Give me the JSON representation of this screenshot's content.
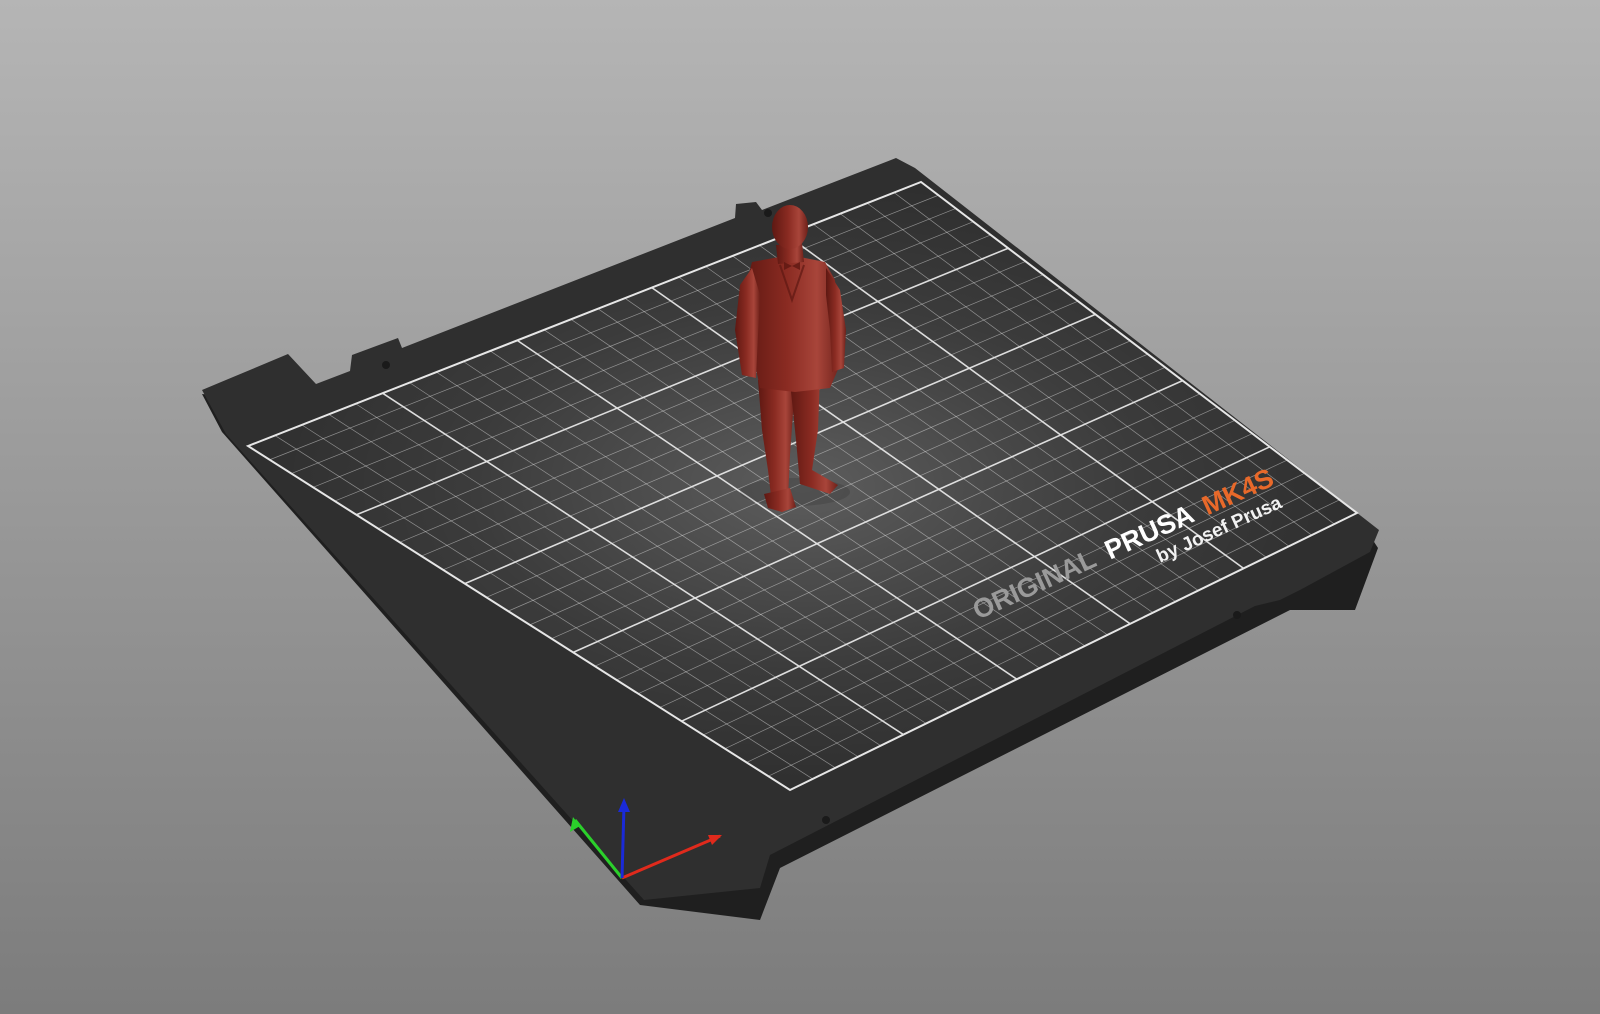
{
  "view": {
    "background_top": "#b5b5b5",
    "background_bottom": "#7c7c7c"
  },
  "bed": {
    "plate_color": "#2f2f2f",
    "plate_edge_color": "#1f1f1f",
    "grid_color": "#e6e6e6",
    "logo": {
      "word1": "ORIGINAL",
      "word2": "PRUSA",
      "word3": "MK4S",
      "subtitle": "by Josef Prusa",
      "word1_color": "#9a9a9a",
      "word2_color": "#ffffff",
      "word3_color": "#e8692a"
    }
  },
  "model": {
    "color": "#8a2b22",
    "highlight": "#a8453a",
    "shadow": "#5e1812"
  },
  "axes": {
    "x_color": "#e02a1c",
    "y_color": "#2bd02b",
    "z_color": "#1a2ad8"
  }
}
